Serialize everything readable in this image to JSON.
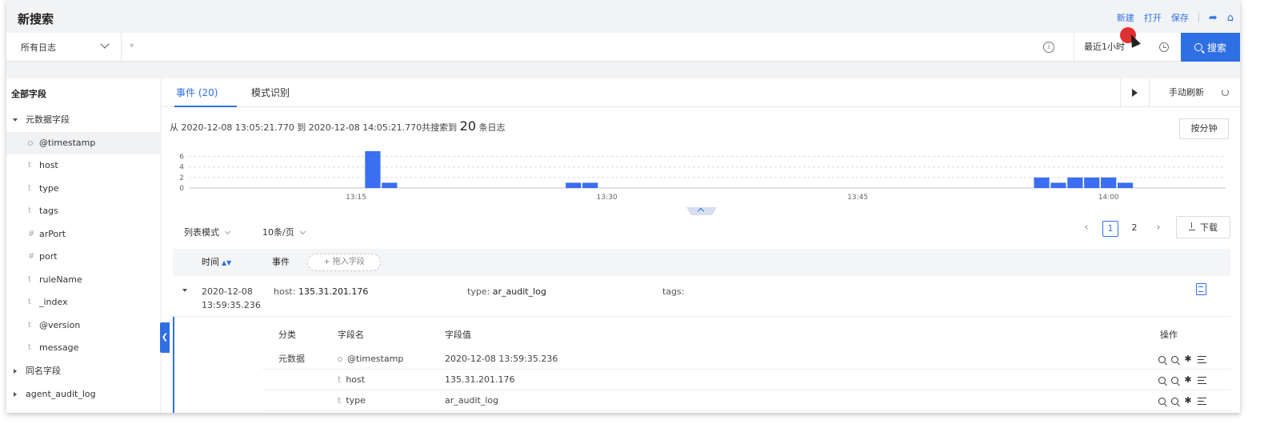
{
  "header": {
    "title": "新搜索",
    "actions": {
      "new": "新建",
      "open": "打开",
      "save": "保存"
    }
  },
  "searchbar": {
    "log_source": "所有日志",
    "query": "*",
    "time_range": "最近1小时",
    "search_label": "搜索"
  },
  "sidebar": {
    "title": "全部字段",
    "groups": [
      {
        "label": "元数据字段",
        "expanded": true
      },
      {
        "label": "同名字段",
        "expanded": false
      },
      {
        "label": "agent_audit_log",
        "expanded": false
      }
    ],
    "fields": [
      {
        "type": "timestamp",
        "name": "@timestamp"
      },
      {
        "type": "t",
        "name": "host"
      },
      {
        "type": "t",
        "name": "type"
      },
      {
        "type": "t",
        "name": "tags"
      },
      {
        "type": "#",
        "name": "arPort"
      },
      {
        "type": "#",
        "name": "port"
      },
      {
        "type": "t",
        "name": "ruleName"
      },
      {
        "type": "t",
        "name": "_index"
      },
      {
        "type": "t",
        "name": "@version"
      },
      {
        "type": "t",
        "name": "message"
      }
    ]
  },
  "main": {
    "tabs": [
      {
        "label": "事件 (20)",
        "active": true
      },
      {
        "label": "模式识别",
        "active": false
      }
    ],
    "refresh_label": "手动刷新",
    "summary": {
      "prefix": "从 2020-12-08 13:05:21.770 到 2020-12-08 14:05:21.770共搜索到",
      "count": "20",
      "suffix": "条日志"
    },
    "interval_label": "按分钟",
    "view_mode": "列表模式",
    "per_page": "10条/页",
    "pages": [
      "1",
      "2"
    ],
    "current_page": "1",
    "download_label": "下载",
    "table_headers": {
      "time": "时间",
      "event": "事件",
      "add_field": "拖入字段"
    },
    "event": {
      "date": "2020-12-08",
      "time": "13:59:35.236",
      "host_label": "host:",
      "host": "135.31.201.176",
      "type_label": "type:",
      "type": "ar_audit_log",
      "tags_label": "tags:"
    },
    "detail": {
      "headers": {
        "category": "分类",
        "field": "字段名",
        "value": "字段值",
        "ops": "操作"
      },
      "category": "元数据",
      "rows": [
        {
          "type": "timestamp",
          "field": "@timestamp",
          "value": "2020-12-08 13:59:35.236"
        },
        {
          "type": "t",
          "field": "host",
          "value": "135.31.201.176"
        },
        {
          "type": "t",
          "field": "type",
          "value": "ar_audit_log"
        }
      ]
    }
  },
  "chart_data": {
    "type": "bar",
    "x_ticks": [
      "13:15",
      "13:30",
      "13:45",
      "14:00"
    ],
    "y_ticks": [
      0,
      2,
      4,
      6
    ],
    "ylim": [
      0,
      7
    ],
    "bar_color": "#3b6ef0",
    "bars": [
      {
        "minute": "13:16",
        "value": 7
      },
      {
        "minute": "13:17",
        "value": 1
      },
      {
        "minute": "13:28",
        "value": 1
      },
      {
        "minute": "13:29",
        "value": 1
      },
      {
        "minute": "13:56",
        "value": 2
      },
      {
        "minute": "13:57",
        "value": 1
      },
      {
        "minute": "13:58",
        "value": 2
      },
      {
        "minute": "13:59",
        "value": 2
      },
      {
        "minute": "14:00",
        "value": 2
      },
      {
        "minute": "14:01",
        "value": 1
      }
    ]
  }
}
